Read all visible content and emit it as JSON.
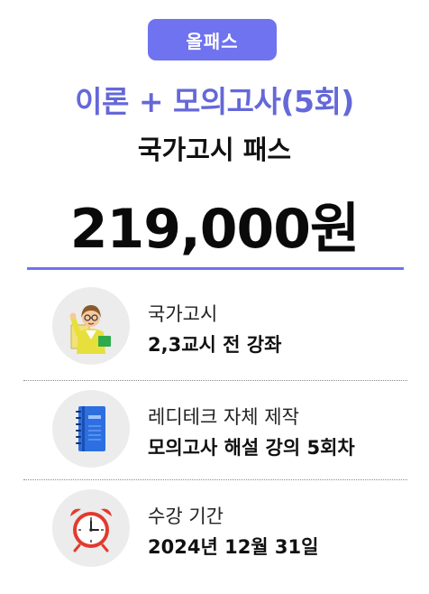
{
  "badge": {
    "label": "올패스"
  },
  "headline": "이론 + 모의고사(5회)",
  "subheadline": "국가고시 패스",
  "price": "219,000원",
  "colors": {
    "accent": "#6f73ef",
    "headline": "#6468d9",
    "icon_bg": "#ececec"
  },
  "features": [
    {
      "icon": "teacher-icon",
      "line1": "국가고시",
      "line2": "2,3교시 전 강좌"
    },
    {
      "icon": "notebook-icon",
      "line1": "레디테크 자체 제작",
      "line2": "모의고사 해설 강의 5회차"
    },
    {
      "icon": "alarm-clock-icon",
      "line1": "수강 기간",
      "line2": "2024년 12월 31일"
    }
  ]
}
